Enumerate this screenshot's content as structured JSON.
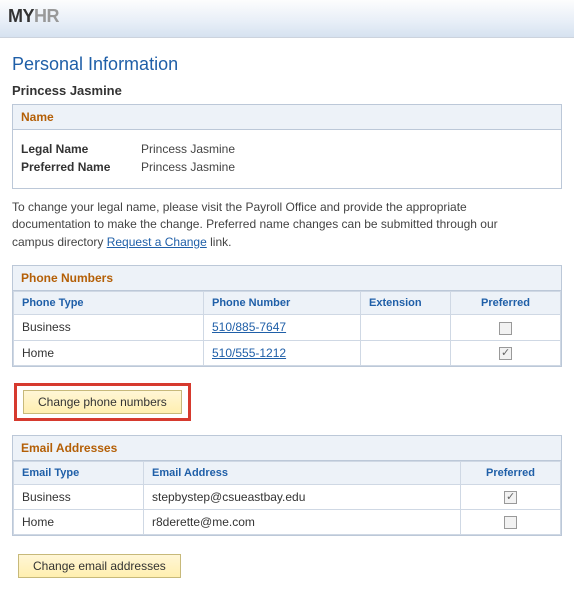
{
  "logo": {
    "part1": "MY",
    "part2": "HR"
  },
  "page": {
    "title": "Personal Information",
    "person_name": "Princess Jasmine"
  },
  "name_section": {
    "header": "Name",
    "legal_label": "Legal Name",
    "legal_value": "Princess Jasmine",
    "preferred_label": "Preferred Name",
    "preferred_value": "Princess Jasmine"
  },
  "helptext": {
    "before_link": "To change your legal name, please visit the Payroll Office and provide the appropriate documentation to make the change. Preferred name changes can be submitted through our campus directory ",
    "link_text": "Request a Change",
    "after_link": " link."
  },
  "phone_section": {
    "header": "Phone Numbers",
    "cols": {
      "type": "Phone Type",
      "number": "Phone Number",
      "ext": "Extension",
      "pref": "Preferred"
    },
    "rows": [
      {
        "type": "Business",
        "number": "510/885-7647",
        "ext": "",
        "preferred": false
      },
      {
        "type": "Home",
        "number": "510/555-1212",
        "ext": "",
        "preferred": true
      }
    ],
    "button": "Change phone numbers"
  },
  "email_section": {
    "header": "Email Addresses",
    "cols": {
      "type": "Email Type",
      "addr": "Email Address",
      "pref": "Preferred"
    },
    "rows": [
      {
        "type": "Business",
        "addr": "stepbystep@csueastbay.edu",
        "preferred": true
      },
      {
        "type": "Home",
        "addr": "r8derette@me.com",
        "preferred": false
      }
    ],
    "button": "Change email addresses"
  }
}
